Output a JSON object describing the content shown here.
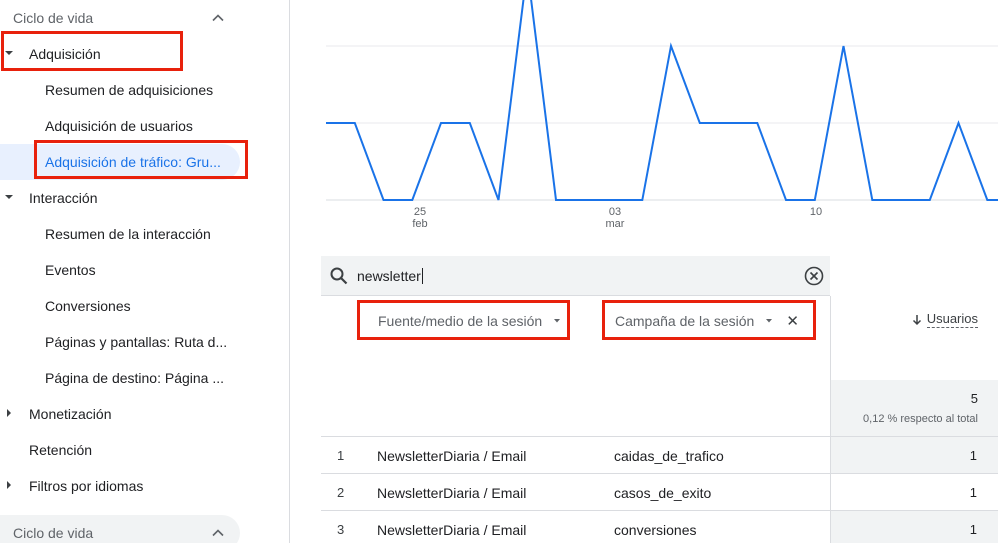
{
  "sidebar": {
    "top_section": "Ciclo de vida",
    "items": [
      {
        "label": "Adquisición"
      },
      {
        "label": "Resumen de adquisiciones"
      },
      {
        "label": "Adquisición de usuarios"
      },
      {
        "label": "Adquisición de tráfico: Gru..."
      },
      {
        "label": "Interacción"
      },
      {
        "label": "Resumen de la interacción"
      },
      {
        "label": "Eventos"
      },
      {
        "label": "Conversiones"
      },
      {
        "label": "Páginas y pantallas: Ruta d..."
      },
      {
        "label": "Página de destino: Página ..."
      },
      {
        "label": "Monetización"
      },
      {
        "label": "Retención"
      },
      {
        "label": "Filtros por idiomas"
      }
    ],
    "bottom_section": "Ciclo de vida"
  },
  "chart_data": {
    "type": "line",
    "x_ticks": [
      {
        "day": "25",
        "month": "feb"
      },
      {
        "day": "03",
        "month": "mar"
      },
      {
        "day": "10",
        "month": ""
      }
    ],
    "series": [
      {
        "values": [
          1,
          1,
          0,
          0,
          1,
          1,
          0,
          3,
          0,
          0,
          0,
          0,
          2,
          1,
          1,
          1,
          0,
          0,
          2,
          0,
          0,
          0,
          1,
          0,
          0
        ]
      }
    ],
    "ylim": [
      0,
      3
    ],
    "grid": true,
    "color": "#1a73e8"
  },
  "search": {
    "value": "newsletter"
  },
  "dimensions": {
    "primary": "Fuente/medio de la sesión",
    "secondary": "Campaña de la sesión"
  },
  "metric": {
    "label": "Usuarios",
    "total": "5",
    "total_pct": "0,12 % respecto al total"
  },
  "rows": [
    {
      "index": "1",
      "source": "NewsletterDiaria / Email",
      "campaign": "caidas_de_trafico",
      "users": "1"
    },
    {
      "index": "2",
      "source": "NewsletterDiaria / Email",
      "campaign": "casos_de_exito",
      "users": "1"
    },
    {
      "index": "3",
      "source": "NewsletterDiaria / Email",
      "campaign": "conversiones",
      "users": "1"
    }
  ],
  "colors": {
    "accent": "#1a73e8",
    "highlight": "#e8210c"
  }
}
